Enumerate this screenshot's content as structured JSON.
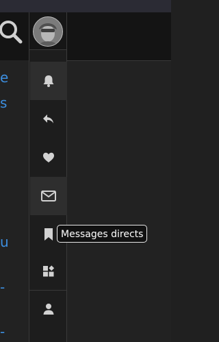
{
  "left_partial_links": [
    "e",
    "s",
    "u",
    "-",
    "-"
  ],
  "rail": {
    "items": [
      {
        "icon": "bell-icon",
        "active": true
      },
      {
        "icon": "reply-icon",
        "active": false
      },
      {
        "icon": "heart-icon",
        "active": false
      },
      {
        "icon": "envelope-icon",
        "active": true
      },
      {
        "icon": "bookmark-icon",
        "active": false
      },
      {
        "icon": "widgets-icon",
        "active": false
      },
      {
        "icon": "user-icon",
        "active": false
      }
    ]
  },
  "tooltip": {
    "text": "Messages directs"
  },
  "colors": {
    "link": "#3d8fe0",
    "icon": "#d2d2d2",
    "rail_active": "#2e2e2e"
  }
}
